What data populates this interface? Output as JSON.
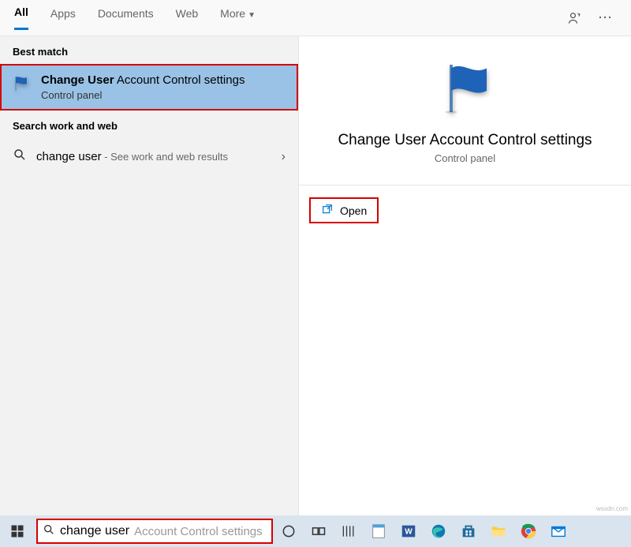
{
  "tabs": {
    "all": "All",
    "apps": "Apps",
    "documents": "Documents",
    "web": "Web",
    "more": "More"
  },
  "sections": {
    "best_match": "Best match",
    "search_web": "Search work and web"
  },
  "best_match": {
    "title_bold": "Change User",
    "title_rest": " Account Control settings",
    "subtitle": "Control panel"
  },
  "web_result": {
    "query": "change user",
    "hint": " - See work and web results"
  },
  "preview": {
    "title": "Change User Account Control settings",
    "subtitle": "Control panel",
    "open": "Open"
  },
  "searchbar": {
    "typed": "change user",
    "suggestion": " Account Control settings"
  },
  "watermark": "wsxdn.com"
}
